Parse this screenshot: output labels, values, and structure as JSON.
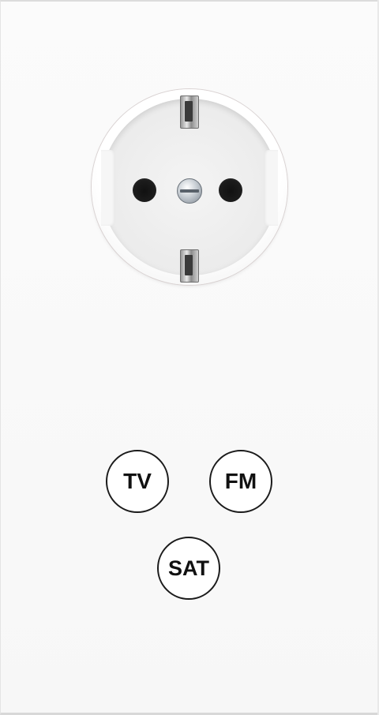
{
  "socket": {
    "type": "schuko",
    "icon": "power-outlet-icon"
  },
  "antenna_ports": [
    {
      "label": "TV"
    },
    {
      "label": "FM"
    },
    {
      "label": "SAT"
    }
  ],
  "colors": {
    "plate": "#f7f7f7",
    "port_border": "#1b1b1b",
    "port_text": "#111111"
  }
}
